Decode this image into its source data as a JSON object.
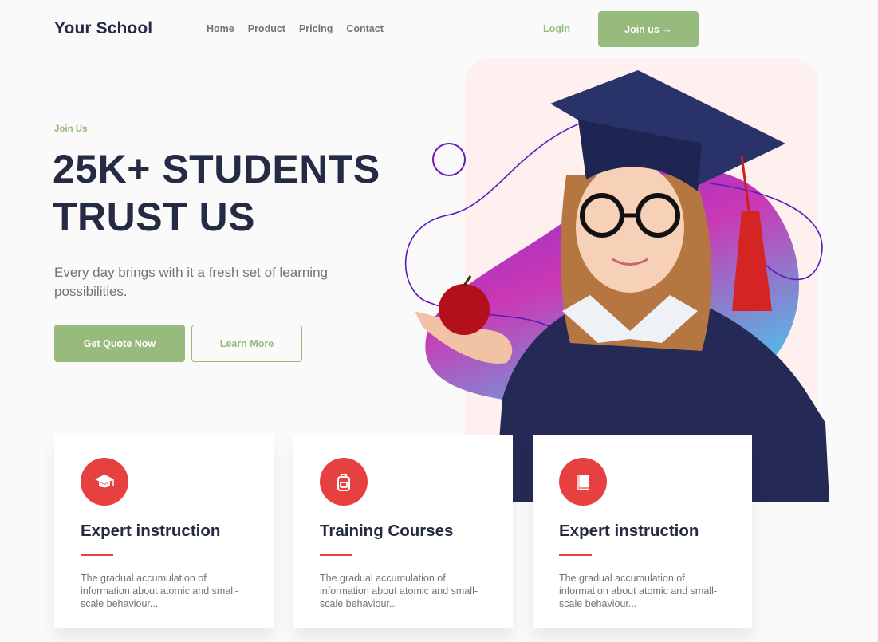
{
  "header": {
    "brand": "Your School",
    "nav": [
      "Home",
      "Product",
      "Pricing",
      "Contact"
    ],
    "login": "Login",
    "join": "Join us →"
  },
  "hero": {
    "eyebrow": "Join Us",
    "title_line1": "25K+ STUDENTS",
    "title_line2": "TRUST US",
    "subtitle": "Every day brings with it a fresh set of learning possibilities.",
    "primary_cta": "Get Quote Now",
    "secondary_cta": "Learn More",
    "image": "graduate-girl-with-apple"
  },
  "features": [
    {
      "icon": "graduation-cap-icon",
      "title": "Expert instruction",
      "desc": "The gradual accumulation of information about atomic and small-scale behaviour..."
    },
    {
      "icon": "backpack-icon",
      "title": "Training Courses",
      "desc": "The gradual accumulation of information about atomic and small-scale behaviour..."
    },
    {
      "icon": "book-icon",
      "title": "Expert instruction",
      "desc": "The gradual accumulation of information about atomic and small-scale behaviour..."
    }
  ],
  "colors": {
    "primary": "#96bb7c",
    "accent": "#e74040",
    "heading": "#252b42",
    "muted": "#737373"
  }
}
